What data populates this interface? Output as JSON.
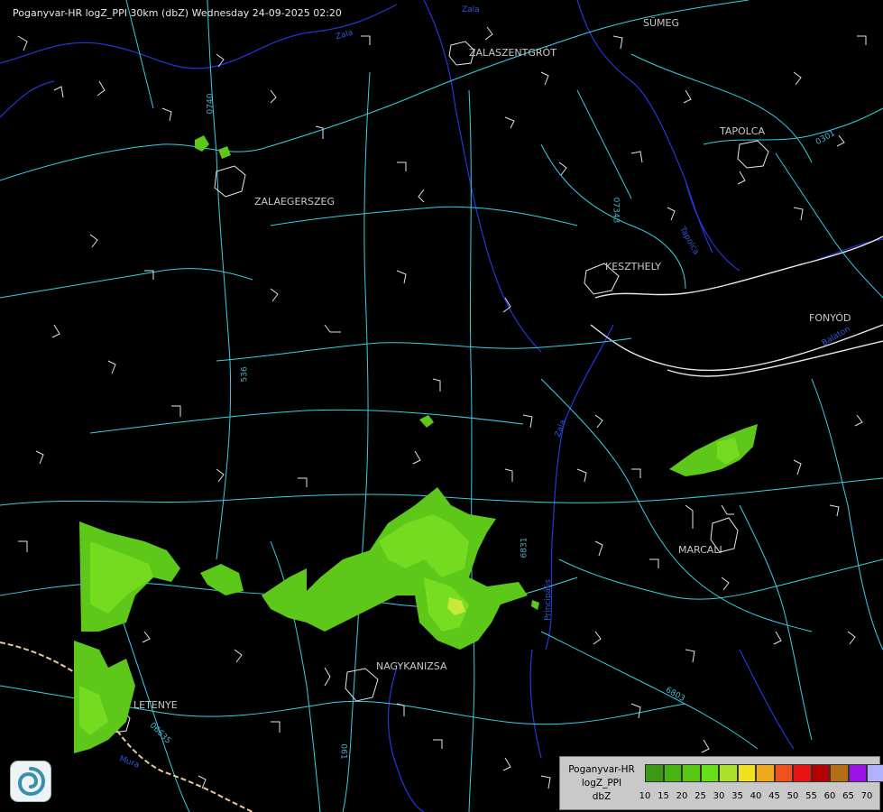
{
  "title": "Poganyvar-HR logZ_PPI 30km (dbZ) Wednesday 24-09-2025 02:20",
  "cities": [
    "SÜMEG",
    "ZALASZENTGRÓT",
    "TAPOLCA",
    "ZALAEGERSZEG",
    "KESZTHELY",
    "FONYÓD",
    "MARCALI",
    "NAGYKANIZSA",
    "LETENYE"
  ],
  "roads": [
    "0740",
    "07343",
    "0301",
    "536",
    "6831",
    "6803",
    "06635",
    "061"
  ],
  "rivers": [
    "Zala",
    "Zala",
    "Tapolca",
    "Balaton",
    "Zala",
    "Principális",
    "Mura"
  ],
  "legend": {
    "line1": "Poganyvar-HR",
    "line2": "logZ_PPI",
    "line3": "dbZ",
    "colors": [
      "#3a9a14",
      "#48b414",
      "#57c814",
      "#66e01a",
      "#a8e12e",
      "#f0e01e",
      "#f0a81e",
      "#f0501e",
      "#e81414",
      "#b40000",
      "#b46e14",
      "#9a14e8",
      "#b0b0ff"
    ],
    "ticks": [
      "10",
      "15",
      "20",
      "25",
      "30",
      "35",
      "40",
      "45",
      "50",
      "55",
      "60",
      "65",
      "70"
    ]
  },
  "logo_icon": "weather-service-logo-icon"
}
